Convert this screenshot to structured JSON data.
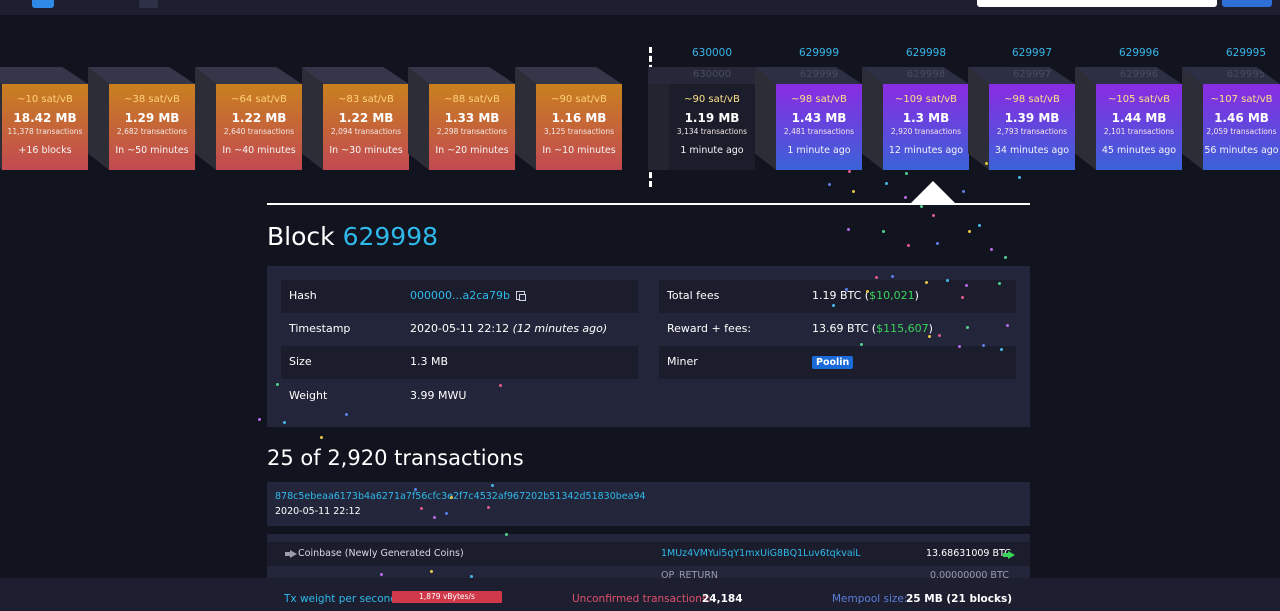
{
  "colors": {
    "accent": "#2fb9ea",
    "pending_gradient_top": "#c9801f",
    "pending_gradient_bottom": "#c24a52",
    "mined_gradient_top": "#8a2be2",
    "mined_gradient_bottom": "#3b62d8",
    "positive": "#3bd45a",
    "badge": "#1a6ad8"
  },
  "pending_blocks": [
    {
      "fee": "~10 sat/vB",
      "size": "18.42 MB",
      "txs": "11,378 transactions",
      "when": "+16 blocks"
    },
    {
      "fee": "~38 sat/vB",
      "size": "1.29 MB",
      "txs": "2,682 transactions",
      "when": "In ~50 minutes"
    },
    {
      "fee": "~64 sat/vB",
      "size": "1.22 MB",
      "txs": "2,640 transactions",
      "when": "In ~40 minutes"
    },
    {
      "fee": "~83 sat/vB",
      "size": "1.22 MB",
      "txs": "2,094 transactions",
      "when": "In ~30 minutes"
    },
    {
      "fee": "~88 sat/vB",
      "size": "1.33 MB",
      "txs": "2,298 transactions",
      "when": "In ~20 minutes"
    },
    {
      "fee": "~90 sat/vB",
      "size": "1.16 MB",
      "txs": "3,125 transactions",
      "when": "In ~10 minutes"
    }
  ],
  "mined_blocks": [
    {
      "height": "630000",
      "fee": "~90 sat/vB",
      "size": "1.19 MB",
      "txs": "3,134 transactions",
      "when": "1 minute ago"
    },
    {
      "height": "629999",
      "fee": "~98 sat/vB",
      "size": "1.43 MB",
      "txs": "2,481 transactions",
      "when": "1 minute ago"
    },
    {
      "height": "629998",
      "fee": "~109 sat/vB",
      "size": "1.3 MB",
      "txs": "2,920 transactions",
      "when": "12 minutes ago"
    },
    {
      "height": "629997",
      "fee": "~98 sat/vB",
      "size": "1.39 MB",
      "txs": "2,793 transactions",
      "when": "34 minutes ago"
    },
    {
      "height": "629996",
      "fee": "~105 sat/vB",
      "size": "1.44 MB",
      "txs": "2,101 transactions",
      "when": "45 minutes ago"
    },
    {
      "height": "629995",
      "fee": "~107 sat/vB",
      "size": "1.46 MB",
      "txs": "2,059 transactions",
      "when": "56 minutes ago"
    }
  ],
  "block": {
    "title_prefix": "Block",
    "height": "629998",
    "hash_label": "Hash",
    "hash_value": "000000...a2ca79b",
    "timestamp_label": "Timestamp",
    "timestamp_value": "2020-05-11 22:12",
    "timestamp_ago": "(12 minutes ago)",
    "size_label": "Size",
    "size_value": "1.3 MB",
    "weight_label": "Weight",
    "weight_value": "3.99 MWU",
    "total_fees_label": "Total fees",
    "total_fees_btc": "1.19 BTC (",
    "total_fees_usd": "$10,021",
    "total_fees_close": ")",
    "reward_label": "Reward + fees:",
    "reward_btc": "13.69 BTC (",
    "reward_usd": "$115,607",
    "reward_close": ")",
    "miner_label": "Miner",
    "miner_value": "Poolin"
  },
  "transactions": {
    "heading": "25 of 2,920 transactions",
    "first": {
      "txid": "878c5ebeaa6173b4a6271a7f56cfc3e2f7c4532af967202b51342d51830bea94",
      "time": "2020-05-11 22:12",
      "input": "Coinbase (Newly Generated Coins)",
      "output_address": "1MUz4VMYui5qY1mxUiG8BQ1Luv6tqkvaiL",
      "output_value": "13.68631009 BTC",
      "op_return_label": "OP_RETURN",
      "op_return_value": "0.00000000 BTC"
    }
  },
  "footer": {
    "weight_label": "Tx weight per second:",
    "weight_value": "1,879 vBytes/s",
    "unconfirmed_label": "Unconfirmed transactions:",
    "unconfirmed_value": "24,184",
    "mempool_label": "Mempool size:",
    "mempool_value": "25 MB (21 blocks)"
  }
}
